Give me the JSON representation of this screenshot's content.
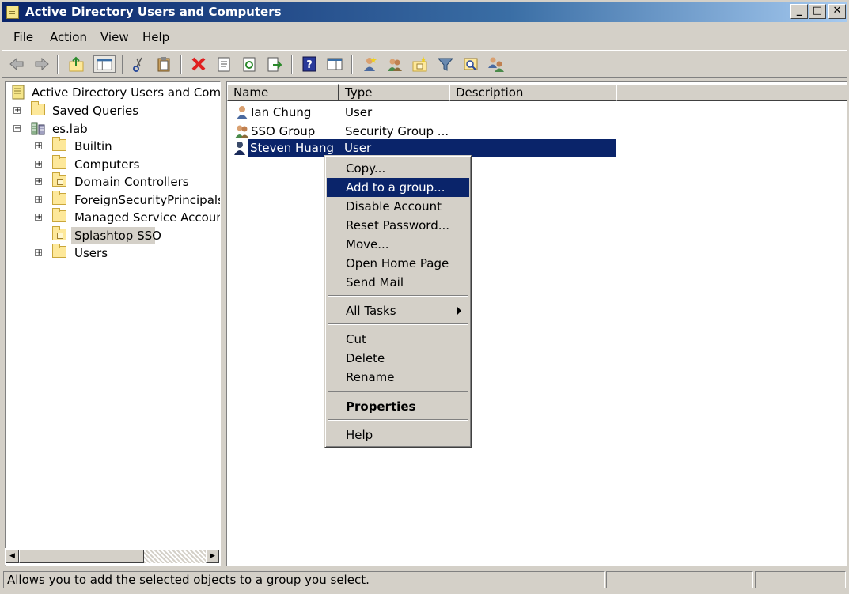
{
  "window": {
    "title": "Active Directory Users and Computers",
    "minimize_glyph": "_",
    "maximize_glyph": "□",
    "close_glyph": "✕"
  },
  "menu": [
    {
      "label": "File"
    },
    {
      "label": "Action"
    },
    {
      "label": "View"
    },
    {
      "label": "Help"
    }
  ],
  "toolbar": {
    "icons": [
      "back-icon",
      "forward-icon",
      "up-folder-icon",
      "show-tree-icon",
      "cut-icon",
      "paste-icon",
      "delete-icon",
      "properties-icon",
      "refresh-icon",
      "export-list-icon",
      "help-icon",
      "show-pane-icon",
      "new-user-icon",
      "new-group-icon",
      "new-ou-icon",
      "filter-icon",
      "find-icon",
      "add-to-group-icon"
    ]
  },
  "tree": {
    "root": "Active Directory Users and Comput",
    "items": [
      {
        "label": "Saved Queries",
        "expander": "+"
      },
      {
        "label": "es.lab",
        "expander": "−"
      },
      {
        "label": "Builtin",
        "expander": "+"
      },
      {
        "label": "Computers",
        "expander": "+"
      },
      {
        "label": "Domain Controllers",
        "expander": "+"
      },
      {
        "label": "ForeignSecurityPrincipals",
        "expander": "+"
      },
      {
        "label": "Managed Service Accounts",
        "expander": "+"
      },
      {
        "label": "Splashtop SSO",
        "expander": ""
      },
      {
        "label": "Users",
        "expander": "+"
      }
    ]
  },
  "list": {
    "columns": [
      "Name",
      "Type",
      "Description"
    ],
    "rows": [
      {
        "name": "Ian Chung",
        "type": "User",
        "icon": "user-icon"
      },
      {
        "name": "SSO Group",
        "type": "Security Group ...",
        "icon": "group-icon"
      },
      {
        "name": "Steven Huang",
        "type": "User",
        "icon": "user-icon",
        "selected": true
      }
    ]
  },
  "context_menu": {
    "items": [
      {
        "label": "Copy..."
      },
      {
        "label": "Add to a group...",
        "highlighted": true
      },
      {
        "label": "Disable Account"
      },
      {
        "label": "Reset Password..."
      },
      {
        "label": "Move..."
      },
      {
        "label": "Open Home Page"
      },
      {
        "label": "Send Mail"
      },
      {
        "label": "All Tasks",
        "submenu": true
      },
      {
        "label": "Cut"
      },
      {
        "label": "Delete"
      },
      {
        "label": "Rename"
      },
      {
        "label": "Properties",
        "bold": true
      },
      {
        "label": "Help"
      }
    ]
  },
  "status": {
    "text": "Allows you to add the selected objects to a group you select."
  },
  "colors": {
    "selection": "#0a246a",
    "face": "#d4d0c8",
    "folder": "#fde89a"
  }
}
